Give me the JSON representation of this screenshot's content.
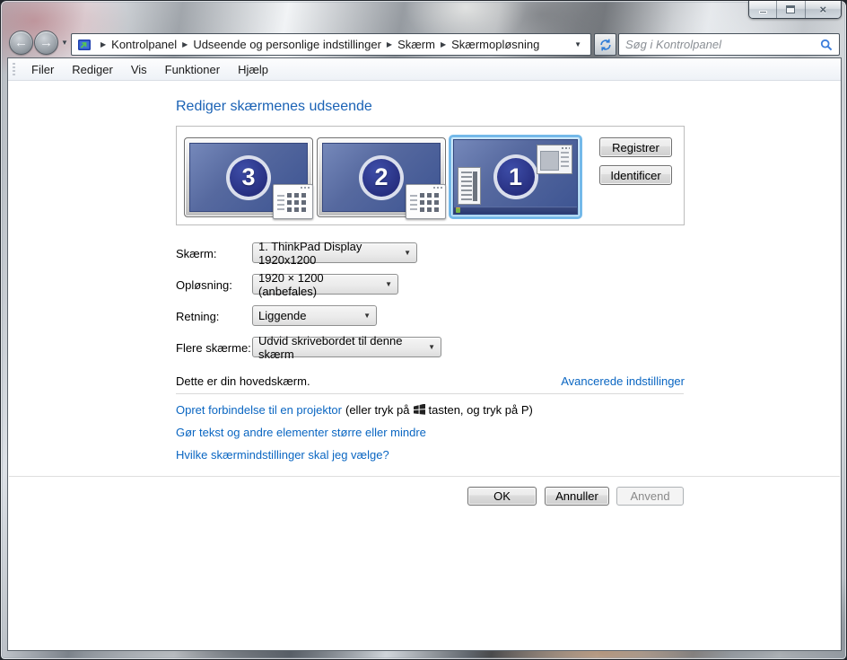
{
  "titlebar": {
    "buttons": {
      "minimize": "minimize",
      "maximize": "maximize",
      "close": "×"
    }
  },
  "navbar": {
    "back_glyph": "←",
    "forward_glyph": "→",
    "breadcrumb": [
      "Kontrolpanel",
      "Udseende og personlige indstillinger",
      "Skærm",
      "Skærmopløsning"
    ],
    "search_placeholder": "Søg i Kontrolpanel"
  },
  "menubar": {
    "items": [
      "Filer",
      "Rediger",
      "Vis",
      "Funktioner",
      "Hjælp"
    ]
  },
  "content": {
    "heading": "Rediger skærmenes udseende",
    "monitors": [
      {
        "number": "3",
        "selected": false
      },
      {
        "number": "2",
        "selected": false
      },
      {
        "number": "1",
        "selected": true
      }
    ],
    "buttons": {
      "detect": "Registrer",
      "identify": "Identificer"
    },
    "fields": [
      {
        "label": "Skærm:",
        "value": "1. ThinkPad Display 1920x1200"
      },
      {
        "label": "Opløsning:",
        "value": "1920 × 1200 (anbefales)"
      },
      {
        "label": "Retning:",
        "value": "Liggende"
      },
      {
        "label": "Flere skærme:",
        "value": "Udvid skrivebordet til denne skærm"
      }
    ],
    "primary_note": "Dette er din hovedskærm.",
    "advanced_settings_link": "Avancerede indstillinger",
    "projector": {
      "link": "Opret forbindelse til en projektor",
      "before_key": "(eller tryk på",
      "after_key": "tasten, og tryk på P)"
    },
    "resize_link": "Gør tekst og andre elementer større eller mindre",
    "help_link": "Hvilke skærmindstillinger skal jeg vælge?",
    "dialog_buttons": {
      "ok": "OK",
      "cancel": "Annuller",
      "apply": "Anvend"
    }
  },
  "colors": {
    "heading_blue": "#1a62b5",
    "link_blue": "#0a66c2",
    "desktop_blue": "#4a6099",
    "selection_border_blue": "#74b9e9",
    "monitor_circle_blue": "#272f80"
  }
}
